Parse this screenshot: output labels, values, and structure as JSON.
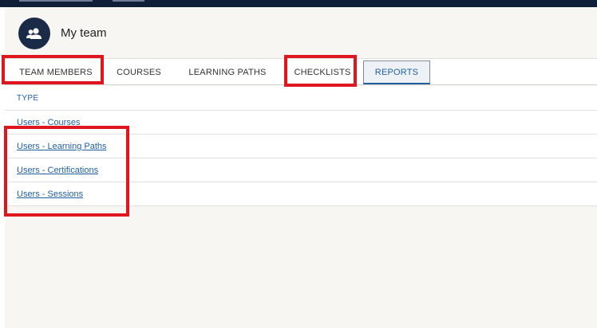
{
  "header": {
    "title": "My team",
    "avatar_icon": "team-icon"
  },
  "tabs": [
    {
      "label": "TEAM MEMBERS",
      "active": false
    },
    {
      "label": "COURSES",
      "active": false
    },
    {
      "label": "LEARNING PATHS",
      "active": false
    },
    {
      "label": "CHECKLISTS",
      "active": false
    },
    {
      "label": "REPORTS",
      "active": true
    }
  ],
  "reports": {
    "column_header": "TYPE",
    "rows": [
      "Users - Courses",
      "Users - Learning Paths",
      "Users - Certifications",
      "Users - Sessions"
    ]
  },
  "colors": {
    "accent": "#1f5f9f",
    "highlight": "#e0161f",
    "top_bar": "#0f1f38"
  }
}
